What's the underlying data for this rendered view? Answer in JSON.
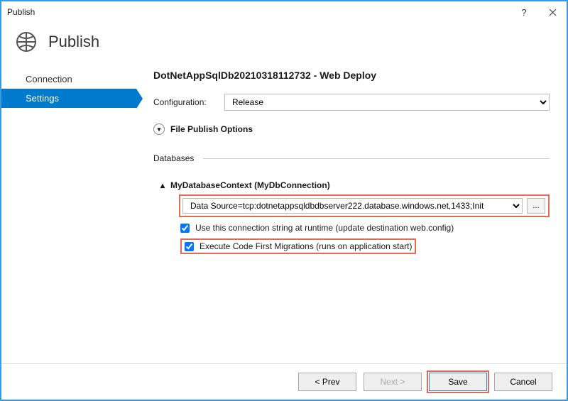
{
  "window": {
    "title": "Publish"
  },
  "header": {
    "heading": "Publish"
  },
  "sidebar": {
    "items": [
      {
        "label": "Connection",
        "selected": false
      },
      {
        "label": "Settings",
        "selected": true
      }
    ]
  },
  "pane": {
    "title": "DotNetAppSqlDb20210318112732 - Web Deploy",
    "config_label": "Configuration:",
    "config_value": "Release",
    "file_publish_label": "File Publish Options",
    "databases_label": "Databases",
    "db_context_label": "MyDatabaseContext (MyDbConnection)",
    "connection_string": "Data Source=tcp:dotnetappsqldbdbserver222.database.windows.net,1433;Init",
    "use_conn_label": "Use this connection string at runtime (update destination web.config)",
    "migrations_label": "Execute Code First Migrations (runs on application start)",
    "ellipsis": "..."
  },
  "footer": {
    "prev": "< Prev",
    "next": "Next >",
    "save": "Save",
    "cancel": "Cancel"
  }
}
